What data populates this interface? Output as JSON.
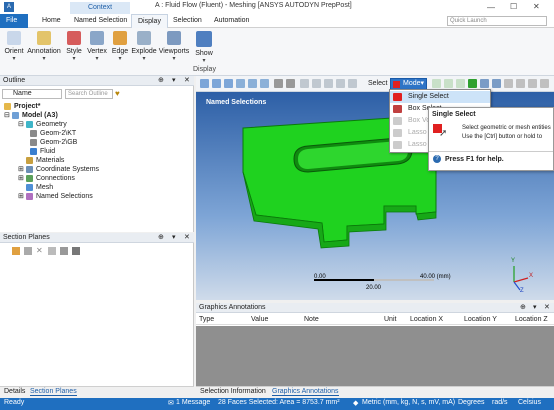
{
  "window": {
    "app_icon": "A",
    "context_label": "Context",
    "title": "A : Fluid Flow (Fluent) - Meshing [ANSYS AUTODYN PrepPost]"
  },
  "ribbon_tabs": [
    "File",
    "Home",
    "Named Selection",
    "Display",
    "Selection",
    "Automation"
  ],
  "active_tab": "Display",
  "quick_launch_placeholder": "Quick Launch",
  "ribbon": {
    "buttons": [
      {
        "label": "Orient",
        "icon": "orient-icon"
      },
      {
        "label": "Annotation",
        "icon": "annotation-icon"
      },
      {
        "label": "Style",
        "icon": "style-icon"
      },
      {
        "label": "Vertex",
        "icon": "vertex-icon"
      },
      {
        "label": "Edge",
        "icon": "edge-icon"
      },
      {
        "label": "Explode",
        "icon": "explode-icon"
      },
      {
        "label": "Viewports",
        "icon": "viewports-icon"
      },
      {
        "label": "Show",
        "icon": "show-icon"
      }
    ],
    "group_label": "Display"
  },
  "outline": {
    "title": "Outline",
    "name_filter": "Name",
    "search_placeholder": "Search Outline",
    "tree": [
      {
        "label": "Project*",
        "level": 0,
        "icon": "project-icon"
      },
      {
        "label": "Model (A3)",
        "level": 1,
        "icon": "model-icon"
      },
      {
        "label": "Geometry",
        "level": 2,
        "icon": "geometry-icon"
      },
      {
        "label": "Geom-2\\KT",
        "level": 3,
        "icon": "body-icon"
      },
      {
        "label": "Geom-2\\GB",
        "level": 3,
        "icon": "body-icon"
      },
      {
        "label": "Fluid",
        "level": 3,
        "icon": "body-icon"
      },
      {
        "label": "Materials",
        "level": 2,
        "icon": "materials-icon"
      },
      {
        "label": "Coordinate Systems",
        "level": 2,
        "icon": "coordinate-icon"
      },
      {
        "label": "Connections",
        "level": 2,
        "icon": "connections-icon"
      },
      {
        "label": "Mesh",
        "level": 2,
        "icon": "mesh-icon"
      },
      {
        "label": "Named Selections",
        "level": 2,
        "icon": "named-selections-icon"
      }
    ]
  },
  "section_planes": {
    "title": "Section Planes"
  },
  "graphics": {
    "select_label": "Select",
    "mode_label": "Mode",
    "viewport_label": "Named Selections",
    "scale_start": "0.00",
    "scale_end": "40.00 (mm)",
    "scale_mid": "20.00",
    "mode_menu": [
      {
        "label": "Single Select",
        "icon": "single-select-icon",
        "enabled": true
      },
      {
        "label": "Box Select",
        "icon": "box-select-icon",
        "enabled": true
      },
      {
        "label": "Box Volume Select",
        "icon": "box-volume-icon",
        "enabled": false
      },
      {
        "label": "Lasso Select",
        "icon": "lasso-icon",
        "enabled": false
      },
      {
        "label": "Lasso Volume Select",
        "icon": "lasso-volume-icon",
        "enabled": false
      }
    ],
    "tooltip": {
      "title": "Single Select",
      "body_line1": "Select geometric or mesh entities",
      "body_line2": "Use the [Ctrl] button or hold to",
      "help": "Press F1 for help."
    },
    "axis_labels": {
      "x": "X",
      "y": "Y",
      "z": "Z"
    },
    "colors": {
      "model": "#1fd21f",
      "selected_icon": "#e02020"
    }
  },
  "annotations": {
    "title": "Graphics Annotations",
    "columns": [
      "Type",
      "Value",
      "Note",
      "Unit",
      "Location X",
      "Location Y",
      "Location Z"
    ]
  },
  "bottom_tabs_left": [
    "Details",
    "Section Planes"
  ],
  "bottom_tabs_right": [
    "Selection Information",
    "Graphics Annotations"
  ],
  "status": {
    "ready": "Ready",
    "messages": "1 Message",
    "selection": "28 Faces Selected: Area = 8753.7 mm²",
    "units": "Metric (mm, kg, N, s, mV, mA)",
    "angle": "Degrees",
    "rate": "rad/s",
    "temp": "Celsius"
  }
}
